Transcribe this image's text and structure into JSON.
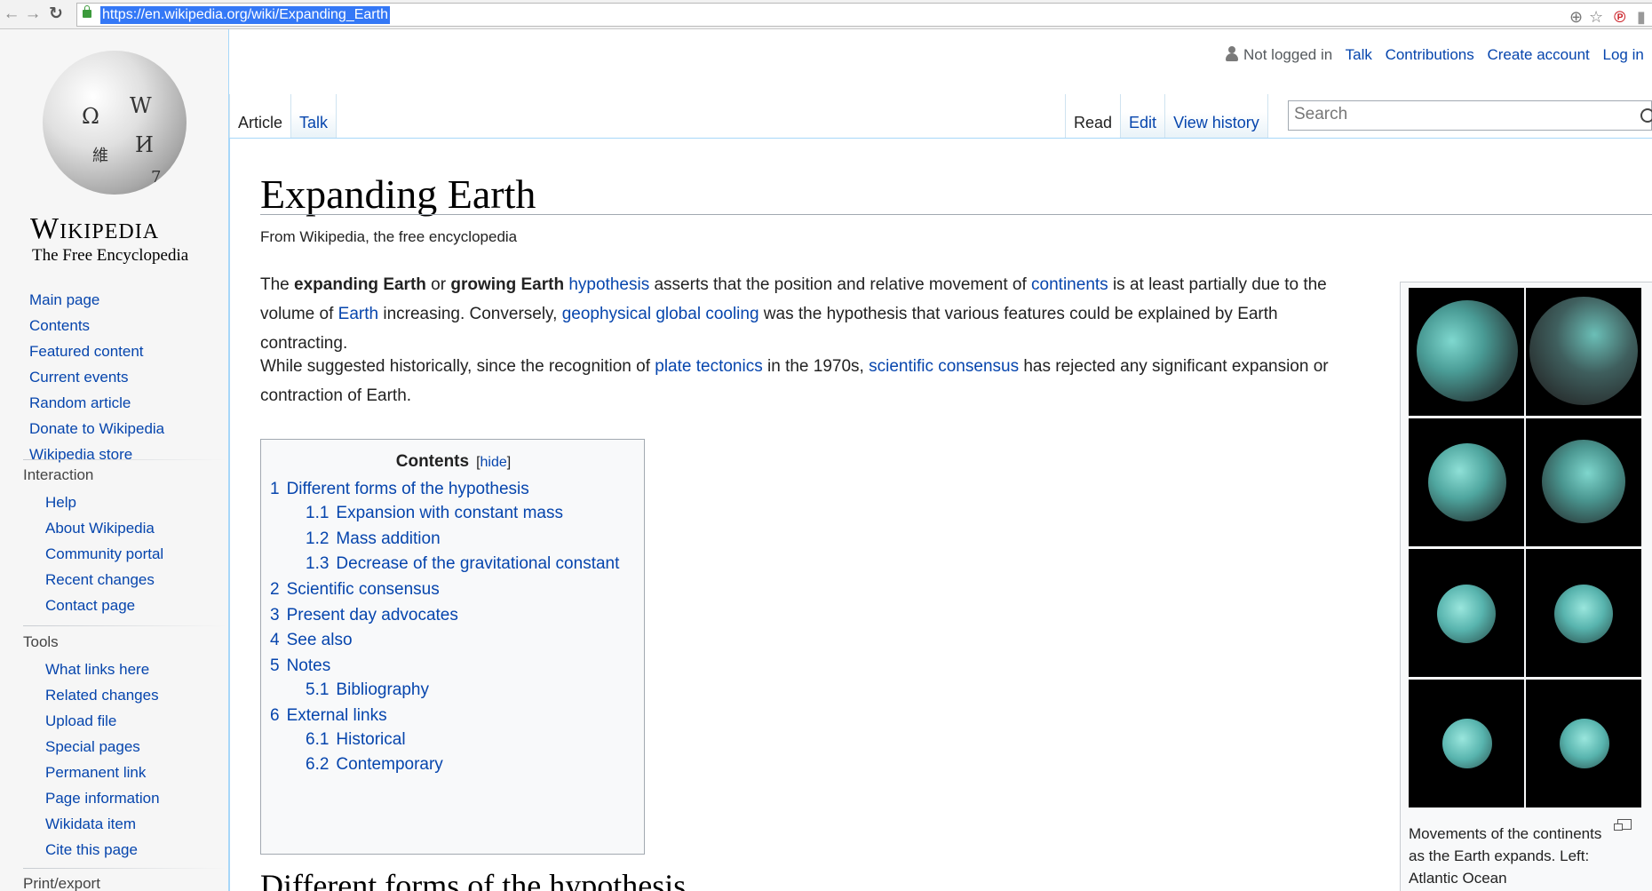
{
  "browser": {
    "url": "https://en.wikipedia.org/wiki/Expanding_Earth",
    "back_icon": "back-arrow-icon",
    "forward_icon": "forward-arrow-icon",
    "reload_icon": "reload-icon"
  },
  "logo": {
    "wordmark": "Wikipedia",
    "tagline": "The Free Encyclopedia",
    "glyphs": [
      "Ω",
      "W",
      "И",
      "維",
      "7"
    ]
  },
  "navigation": [
    "Main page",
    "Contents",
    "Featured content",
    "Current events",
    "Random article",
    "Donate to Wikipedia",
    "Wikipedia store"
  ],
  "interaction": {
    "heading": "Interaction",
    "items": [
      "Help",
      "About Wikipedia",
      "Community portal",
      "Recent changes",
      "Contact page"
    ]
  },
  "tools": {
    "heading": "Tools",
    "items": [
      "What links here",
      "Related changes",
      "Upload file",
      "Special pages",
      "Permanent link",
      "Page information",
      "Wikidata item",
      "Cite this page"
    ]
  },
  "print_export": {
    "heading": "Print/export"
  },
  "personal": {
    "not_logged_in": "Not logged in",
    "talk": "Talk",
    "contributions": "Contributions",
    "create_account": "Create account",
    "login": "Log in"
  },
  "tabs": {
    "article": "Article",
    "talk": "Talk",
    "read": "Read",
    "edit": "Edit",
    "view_history": "View history"
  },
  "search": {
    "placeholder": "Search"
  },
  "article": {
    "title": "Expanding Earth",
    "site_sub": "From Wikipedia, the free encyclopedia",
    "p1": {
      "t1": "The ",
      "b1": "expanding Earth",
      "t2": " or ",
      "b2": "growing Earth",
      "t3": " ",
      "l1": "hypothesis",
      "t4": " asserts that the position and relative movement of ",
      "l2": "continents",
      "t5": " is at least partially due to the volume of ",
      "l3": "Earth",
      "t6": " increasing. Conversely, ",
      "l4": "geophysical global cooling",
      "t7": " was the hypothesis that various features could be explained by Earth contracting."
    },
    "p2": {
      "t1": "While suggested historically, since the recognition of ",
      "l1": "plate tectonics",
      "t2": " in the 1970s, ",
      "l2": "scientific consensus",
      "t3": " has rejected any significant expansion or contraction of Earth."
    },
    "next_heading": "Different forms of the hypothesis"
  },
  "toc": {
    "title": "Contents",
    "hide_open": "[",
    "hide": "hide",
    "hide_close": "]",
    "items": [
      {
        "num": "1",
        "text": "Different forms of the hypothesis"
      },
      {
        "num": "1.1",
        "text": "Expansion with constant mass"
      },
      {
        "num": "1.2",
        "text": "Mass addition"
      },
      {
        "num": "1.3",
        "text": "Decrease of the gravitational constant"
      },
      {
        "num": "2",
        "text": "Scientific consensus"
      },
      {
        "num": "3",
        "text": "Present day advocates"
      },
      {
        "num": "4",
        "text": "See also"
      },
      {
        "num": "5",
        "text": "Notes"
      },
      {
        "num": "5.1",
        "text": "Bibliography"
      },
      {
        "num": "6",
        "text": "External links"
      },
      {
        "num": "6.1",
        "text": "Historical"
      },
      {
        "num": "6.2",
        "text": "Contemporary"
      }
    ]
  },
  "thumb": {
    "caption": "Movements of the continents as the Earth expands. Left: Atlantic Ocean"
  },
  "colors": {
    "link": "#0645ad",
    "ocean": "#58b4ae",
    "panel_border": "#a7d7f9"
  }
}
